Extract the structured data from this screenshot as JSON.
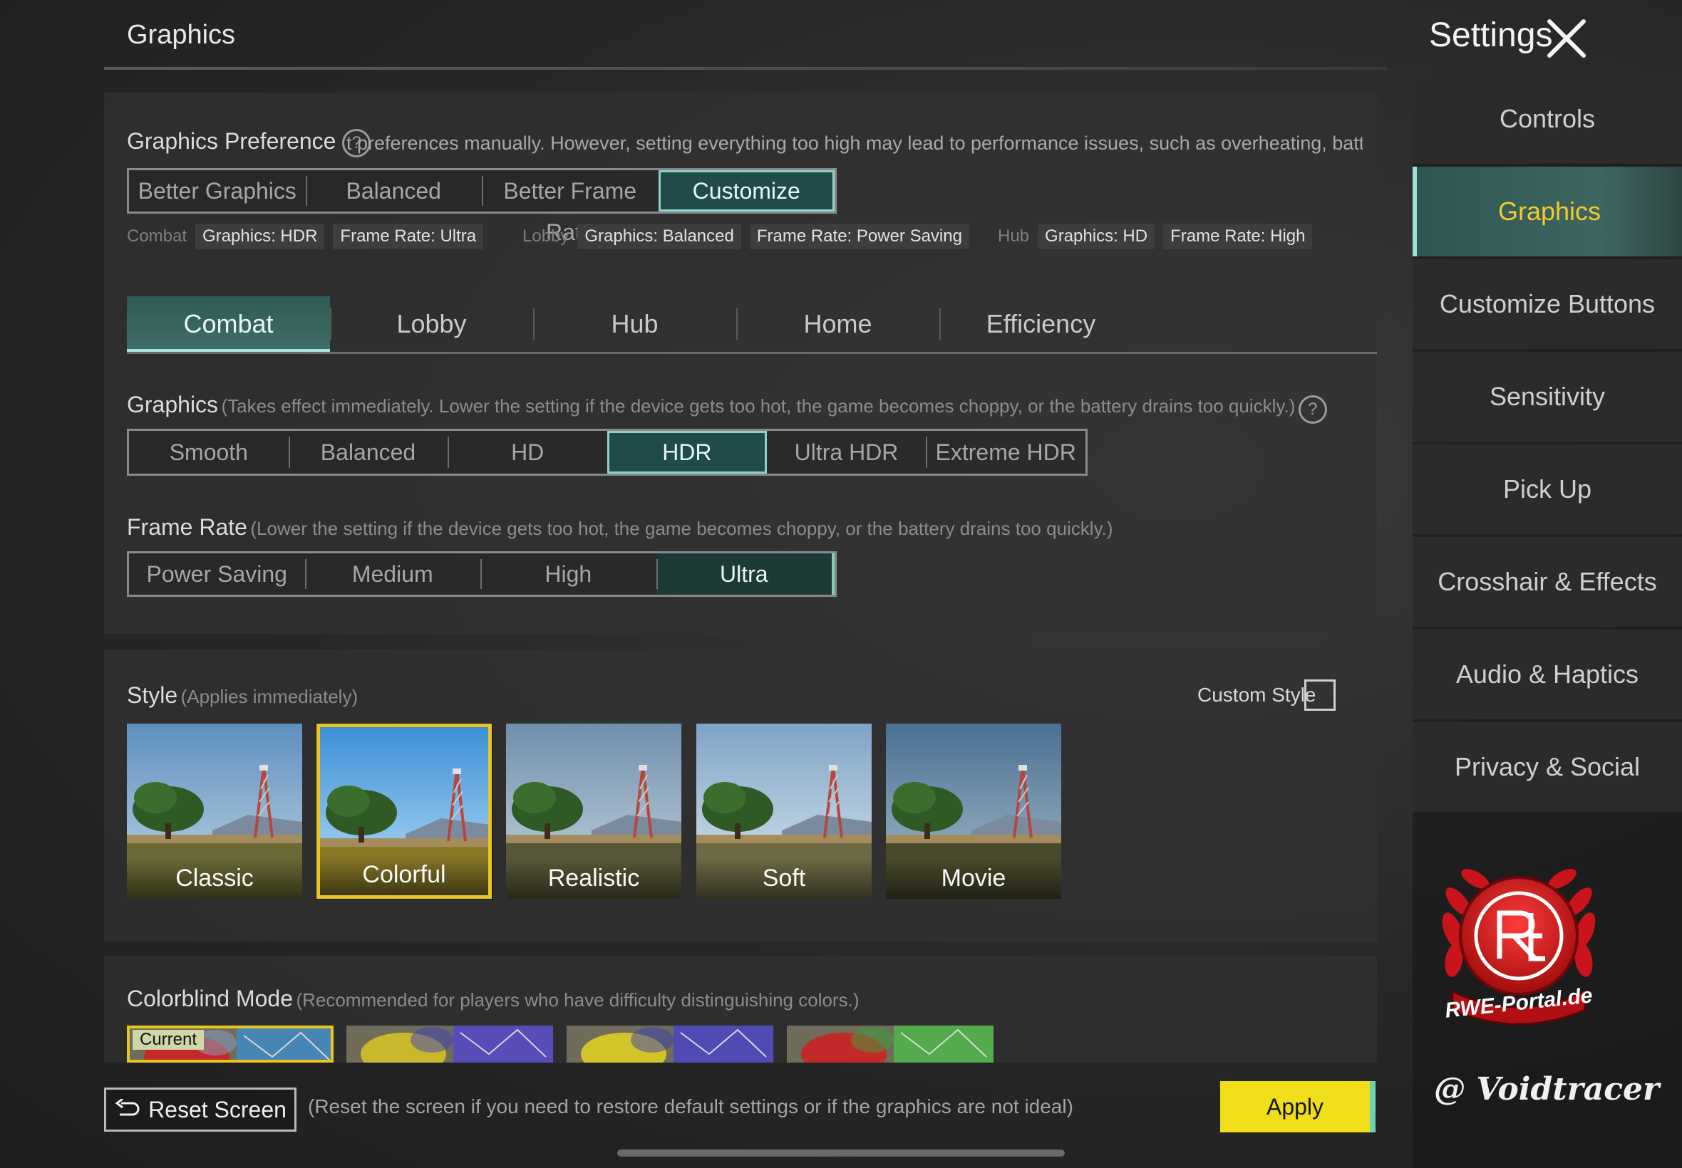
{
  "header": {
    "page_title": "Graphics",
    "settings_title": "Settings"
  },
  "preference": {
    "label": "Graphics Preference",
    "help": "?",
    "scroll_text": "t preferences manually. However, setting everything too high may lead to performance issues, such as overheating, battery drain, or ch",
    "options": [
      "Better Graphics",
      "Balanced",
      "Better Frame Rate",
      "Customize"
    ],
    "selected": "Customize",
    "summary": [
      {
        "label": "Combat",
        "graphics": "Graphics: HDR",
        "frame_rate": "Frame Rate: Ultra"
      },
      {
        "label": "Lobby",
        "graphics": "Graphics: Balanced",
        "frame_rate": "Frame Rate: Power Saving"
      },
      {
        "label": "Hub",
        "graphics": "Graphics: HD",
        "frame_rate": "Frame Rate: High"
      }
    ]
  },
  "tabs": [
    "Combat",
    "Lobby",
    "Hub",
    "Home",
    "Efficiency"
  ],
  "active_tab": "Combat",
  "graphics": {
    "label": "Graphics",
    "hint": "(Takes effect immediately. Lower the setting if the device gets too hot, the game becomes choppy, or the battery drains too quickly.)",
    "help": "?",
    "options": [
      "Smooth",
      "Balanced",
      "HD",
      "HDR",
      "Ultra HDR",
      "Extreme HDR"
    ],
    "selected": "HDR"
  },
  "frame_rate": {
    "label": "Frame Rate",
    "hint": "(Lower the setting if the device gets too hot, the game becomes choppy, or the battery drains too quickly.)",
    "options": [
      "Power Saving",
      "Medium",
      "High",
      "Ultra"
    ],
    "selected": "Ultra"
  },
  "style": {
    "label": "Style",
    "hint": "(Applies immediately)",
    "custom_label": "Custom Style",
    "custom_checked": false,
    "cards": [
      "Classic",
      "Colorful",
      "Realistic",
      "Soft",
      "Movie"
    ],
    "selected": "Colorful"
  },
  "colorblind": {
    "label": "Colorblind Mode",
    "hint": "(Recommended for players who have difficulty distinguishing colors.)",
    "current_badge": "Current"
  },
  "bottom": {
    "reset_label": "Reset Screen",
    "reset_hint": "(Reset the screen if you need to restore default settings or if the graphics are not ideal)",
    "apply_label": "Apply"
  },
  "sidebar": {
    "items": [
      "Controls",
      "Graphics",
      "Customize Buttons",
      "Sensitivity",
      "Pick Up",
      "Crosshair & Effects",
      "Audio & Haptics",
      "Privacy & Social"
    ],
    "active": "Graphics"
  },
  "watermarks": {
    "logo_text": "RWE-Portal.de",
    "handle": "@ Voidtracer"
  },
  "colors": {
    "accent_teal": "#1f4c4a",
    "highlight_yellow": "#e8c51f",
    "apply_yellow": "#f0de1b",
    "active_sidebar_text": "#f3cb2b"
  }
}
